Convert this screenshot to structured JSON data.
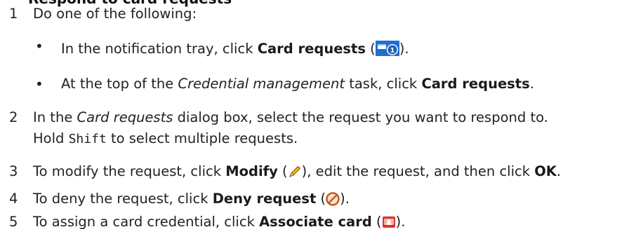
{
  "heading": "Respond to card requests",
  "steps": [
    {
      "n": "1",
      "text": "Do one of the following:"
    },
    {
      "n": "2",
      "pre": "In the ",
      "em": "Card requests",
      "post": " dialog box, select the request you want to respond to.",
      "line2_pre": "Hold ",
      "line2_key": "Shift",
      "line2_post": " to select multiple requests."
    },
    {
      "n": "3",
      "pre": "To modify the request, click ",
      "bold": "Modify",
      "open": " (",
      "post": "), edit the request, and then click ",
      "bold2": "OK",
      "end": "."
    },
    {
      "n": "4",
      "pre": "To deny the request, click ",
      "bold": "Deny request",
      "open": " (",
      "post": ")."
    },
    {
      "n": "5",
      "pre": "To assign a card credential, click ",
      "bold": "Associate card",
      "open": " (",
      "post": ")."
    }
  ],
  "bullets": [
    {
      "mark": "•",
      "pre": "In the notification tray, click ",
      "bold": "Card requests",
      "open": " (",
      "post": ").",
      "icon": "card-requests-tray-icon",
      "badge": "1"
    },
    {
      "mark": "•",
      "pre": "At the top of the ",
      "em": "Credential management",
      "mid": " task, click ",
      "bold": "Card requests",
      "post": "."
    }
  ],
  "icons": {
    "card_requests": "card-requests-tray-icon",
    "modify": "pencil-icon",
    "deny": "deny-icon",
    "associate": "associate-card-icon"
  }
}
